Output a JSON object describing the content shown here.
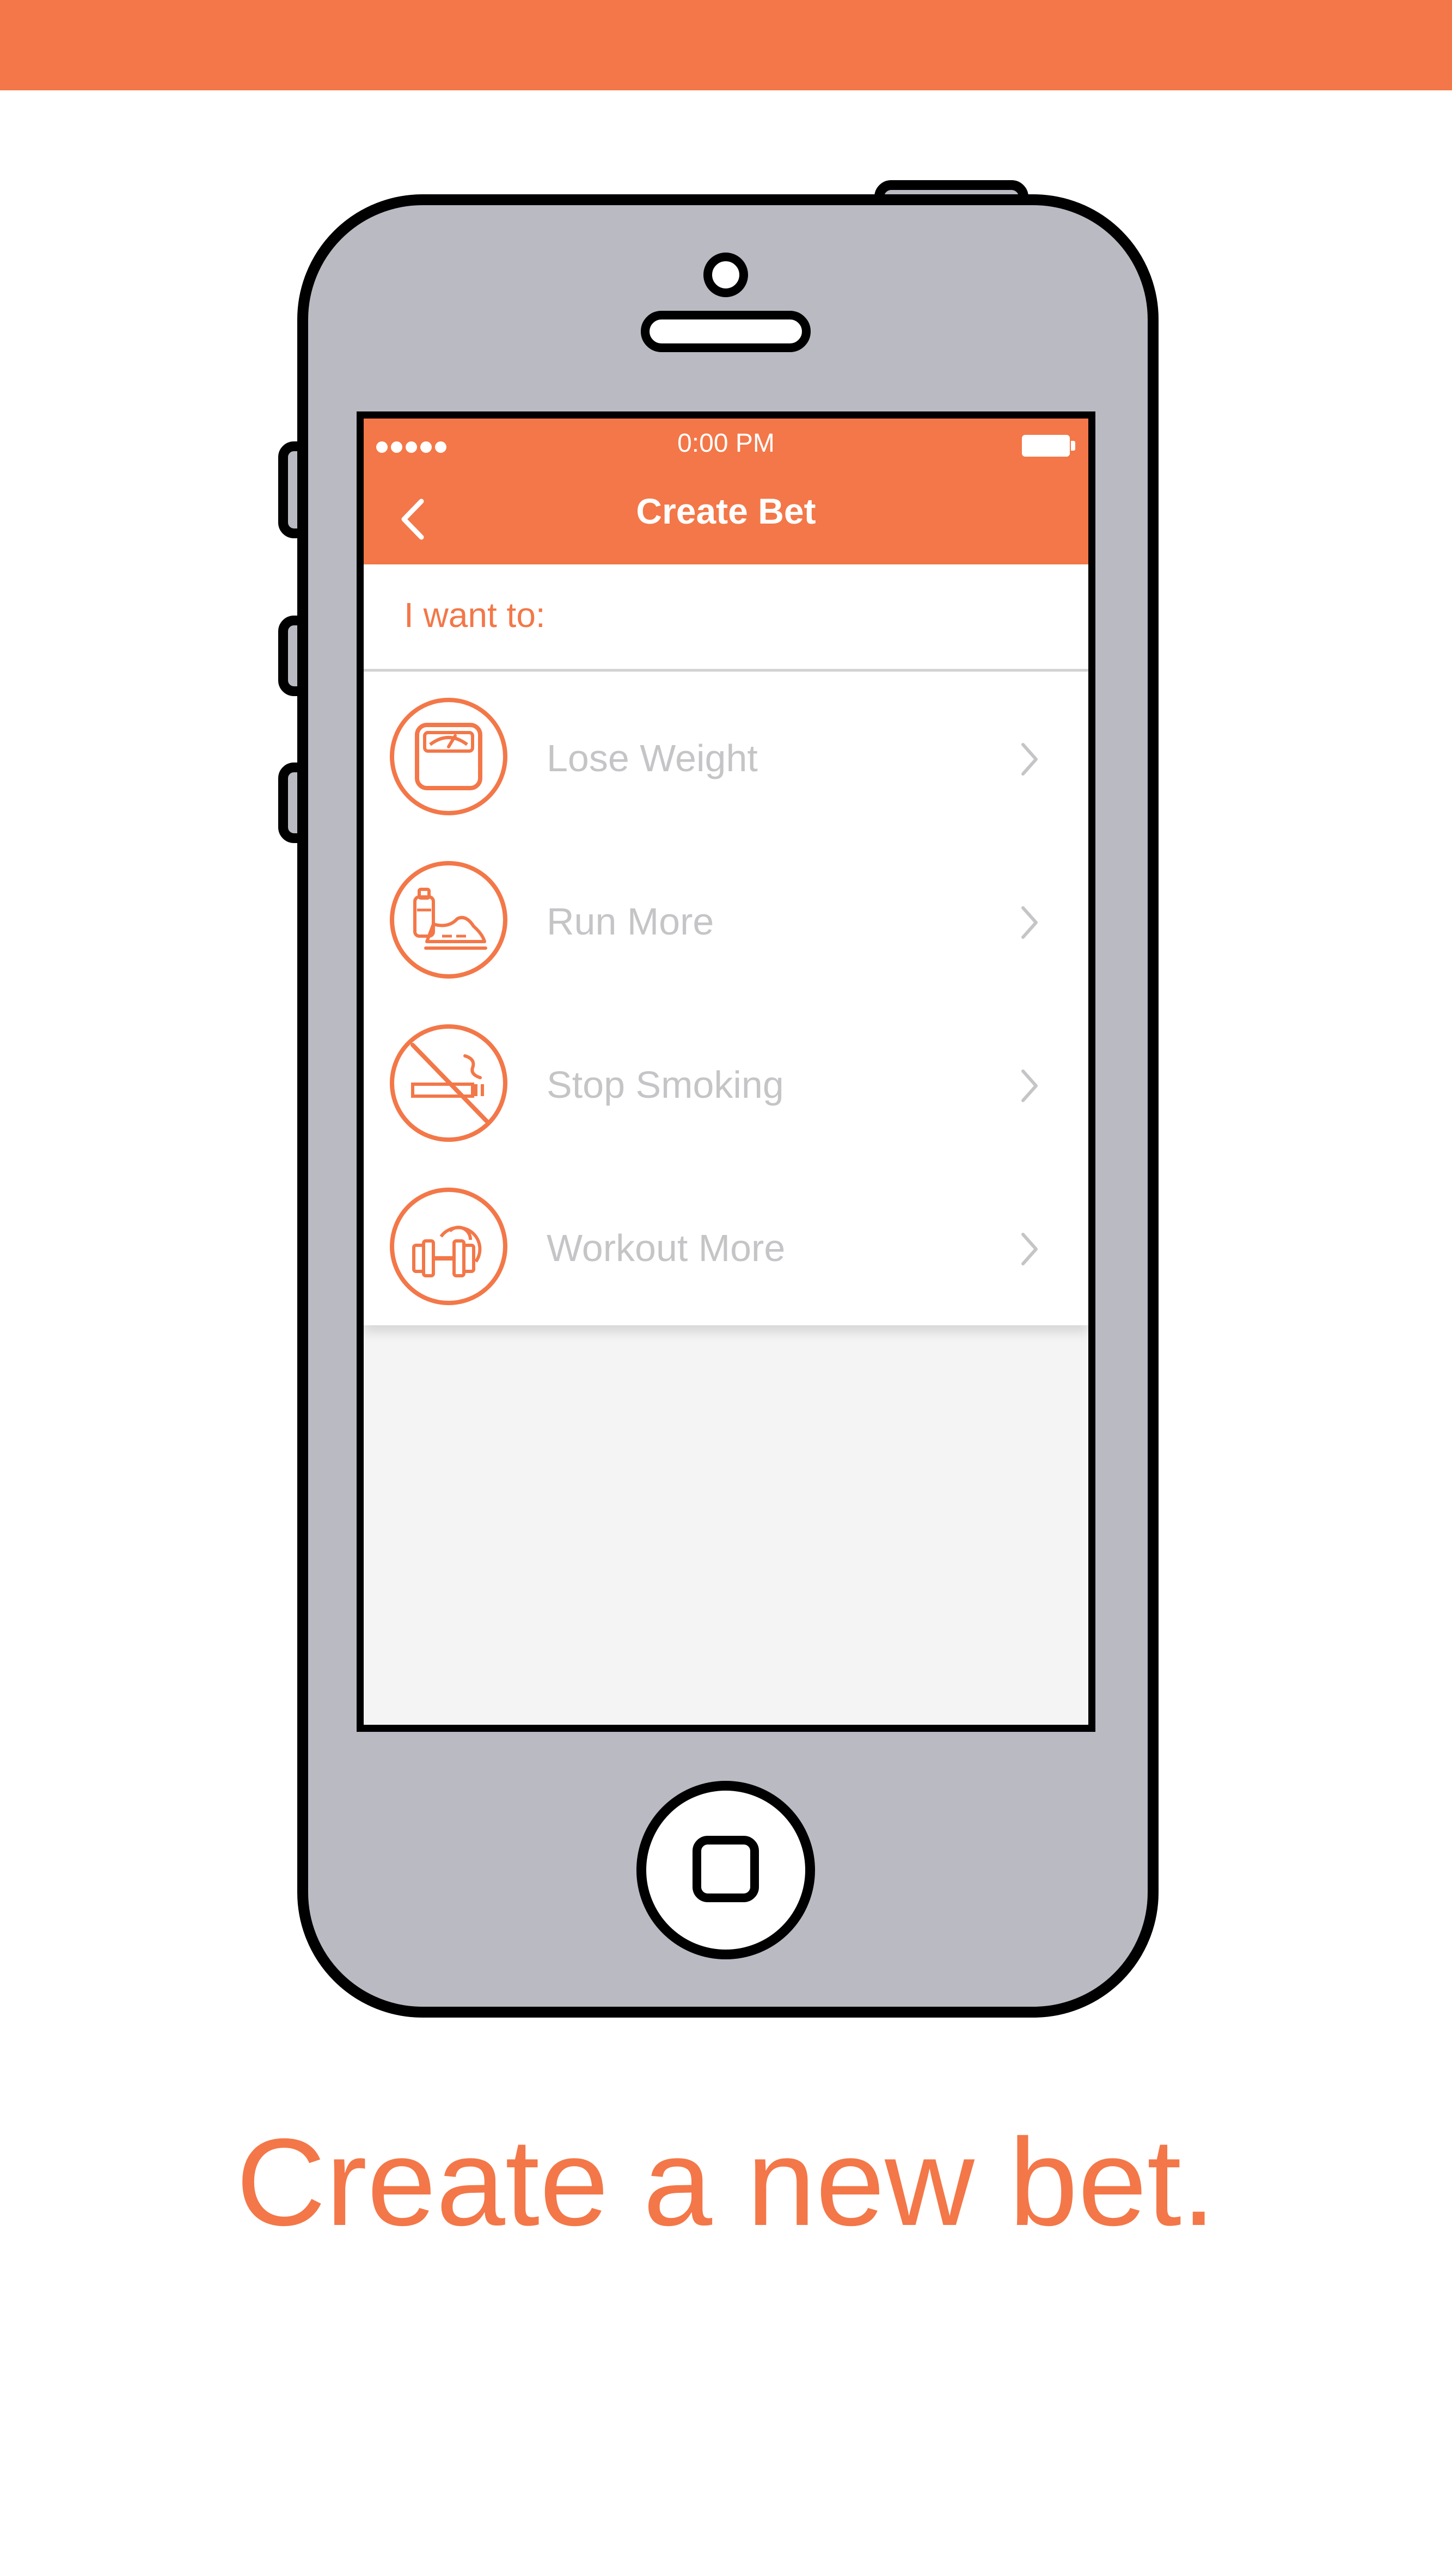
{
  "colors": {
    "accent": "#F37748",
    "phone_body": "#B9BAC2",
    "label_gray": "#C5C5C8"
  },
  "status_bar": {
    "time": "0:00 PM",
    "signal_icon": "signal-dots-icon",
    "battery_icon": "battery-icon"
  },
  "nav": {
    "back_icon": "chevron-left-icon",
    "title": "Create Bet"
  },
  "section": {
    "label": "I want to:"
  },
  "options": [
    {
      "label": "Lose Weight",
      "icon": "scale-icon"
    },
    {
      "label": "Run More",
      "icon": "running-shoe-icon"
    },
    {
      "label": "Stop Smoking",
      "icon": "no-smoking-icon"
    },
    {
      "label": "Workout More",
      "icon": "dumbbell-icon"
    }
  ],
  "tagline": "Create a new bet."
}
